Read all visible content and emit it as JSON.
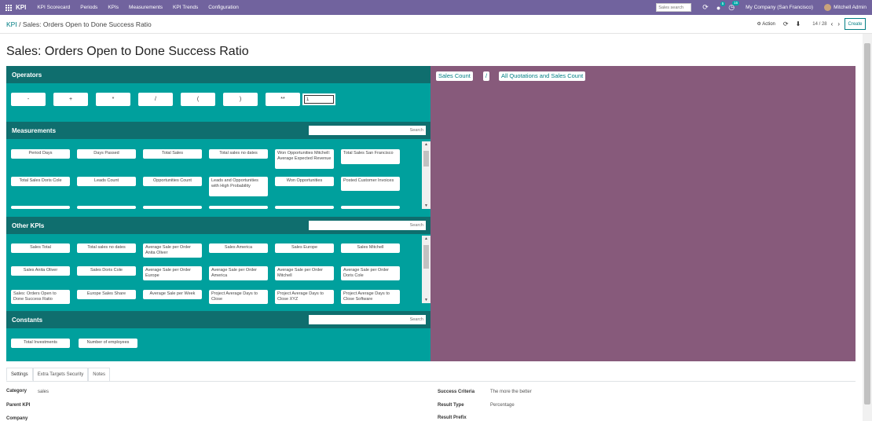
{
  "navbar": {
    "brand": "KPI",
    "menu": [
      "KPI Scorecard",
      "Periods",
      "KPIs",
      "Measurements",
      "KPI Trends",
      "Configuration"
    ],
    "search_placeholder": "Sales search",
    "messages_badge": "5",
    "activities_badge": "16",
    "company": "My Company (San Francisco)",
    "user": "Mitchell Admin"
  },
  "control": {
    "breadcrumb_root": "KPI",
    "breadcrumb_sep": "/",
    "breadcrumb_current": "Sales: Orders Open to Done Success Ratio",
    "action_label": "Action",
    "pager": "14 / 28",
    "create_label": "Create"
  },
  "form": {
    "title": "Sales: Orders Open to Done Success Ratio"
  },
  "builder": {
    "operators_title": "Operators",
    "operators": [
      "-",
      "+",
      "*",
      "/",
      "(",
      ")",
      "**"
    ],
    "number_input_value": "1",
    "measurements_title": "Measurements",
    "measurements_search": "Search",
    "measurements": [
      "Period Days",
      "Days Passed",
      "Total Sales",
      "Total sales no dates",
      "Won Opportunities Mitchell: Average Expected Revenue",
      "Total Sales San Francisco",
      "Total Sales Doris Cole",
      "Leads Count",
      "Opportunities Count",
      "Leads and Opportunities with High Probability",
      "Won Opportunities",
      "Posted Customer Invoices"
    ],
    "other_kpis_title": "Other KPIs",
    "other_kpis_search": "Search",
    "other_kpis": [
      "Sales Total",
      "Total sales no dates",
      "Average Sale per Order Anita Oliver",
      "Sales America",
      "Sales Europe",
      "Sales Mitchell",
      "Sales Anita Oliver",
      "Sales Doris Cole",
      "Average Sale per Order Europe",
      "Average Sale per Order America",
      "Average Sale per Order Mitchell",
      "Average Sale per Order Doris Cole",
      "Sales: Orders Open to Done Success Ratio",
      "Europe Sales Share",
      "Average Sale per Week",
      "Project Average Days to Close",
      "Project Average Days to Close XYZ",
      "Project Average Days to Close Software"
    ],
    "constants_title": "Constants",
    "constants_search": "Search",
    "constants": [
      "Total Investments",
      "Number of employees"
    ],
    "formula": [
      "Sales Count",
      "/",
      "All Quotations and Sales Count"
    ]
  },
  "notebook": {
    "tabs": [
      "Settings",
      "Extra Targets Security",
      "Notes"
    ],
    "fields": {
      "category_label": "Category",
      "category_value": "sales",
      "parent_label": "Parent KPI",
      "company_label": "Company",
      "success_label": "Success Criteria",
      "success_value": "The more the better",
      "result_type_label": "Result Type",
      "result_type_value": "Percentage",
      "result_prefix_label": "Result Prefix"
    }
  },
  "colors": {
    "navbar": "#71639e",
    "teal": "#00a09d",
    "teal_dark": "#0f6e6e",
    "mauve": "#875a7b",
    "link": "#017e84"
  }
}
